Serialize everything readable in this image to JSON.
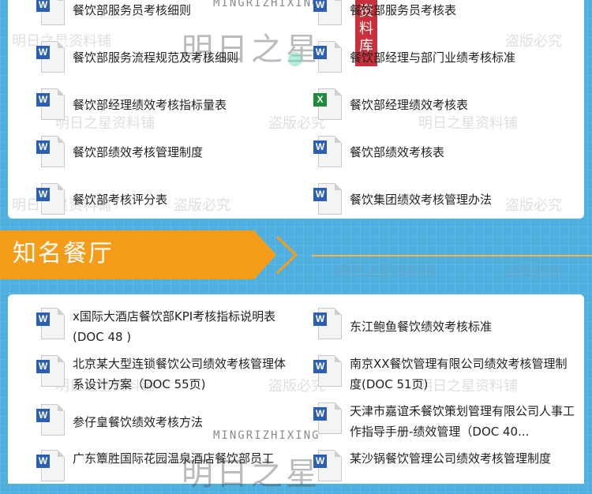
{
  "section_top": {
    "files": [
      {
        "name": "餐饮部服务员考核细则",
        "type": "word"
      },
      {
        "name": "餐饮部服务员考核表",
        "type": "word"
      },
      {
        "name": "餐饮部服务流程规范及考核细则",
        "type": "word"
      },
      {
        "name": "餐饮部经理与部门业绩考核标准",
        "type": "word"
      },
      {
        "name": "餐饮部经理绩效考核指标量表",
        "type": "word"
      },
      {
        "name": "餐饮部经理绩效考核表",
        "type": "excel"
      },
      {
        "name": "餐饮部绩效考核管理制度",
        "type": "word"
      },
      {
        "name": "餐饮部绩效考核表",
        "type": "word"
      },
      {
        "name": "餐饮部考核评分表",
        "type": "word"
      },
      {
        "name": "餐饮集团绩效考核管理办法",
        "type": "word"
      }
    ]
  },
  "banner": {
    "title": "知名餐厅"
  },
  "section_bottom": {
    "files": [
      {
        "name": "x国际大酒店餐饮部KPI考核指标说明表(DOC 48 )",
        "type": "word"
      },
      {
        "name": "东江鲍鱼餐饮绩效考核标准",
        "type": "word"
      },
      {
        "name": "北京某大型连锁餐饮公司绩效考核管理体系设计方案（DOC 55页)",
        "type": "word"
      },
      {
        "name": "南京XX餐饮管理有限公司绩效考核管理制度(DOC 51页)",
        "type": "word"
      },
      {
        "name": "参仔皇餐饮绩效考核方法",
        "type": "word"
      },
      {
        "name": "天津市嘉谊禾餐饮策划管理有限公司人事工作指导手册-绩效管理（DOC 40...",
        "type": "word"
      },
      {
        "name": "广东簟胜国际花园温泉酒店餐饮部员工",
        "type": "word"
      },
      {
        "name": "某沙锅餐饮管理公司绩效考核管理制度",
        "type": "word"
      }
    ]
  },
  "watermarks": {
    "brand": "明日之星资料铺",
    "notice": "盗版必究",
    "pinyin": "MINGRIZHIXING",
    "logo": "明日之星",
    "stamp": "资料库"
  },
  "icons": {
    "word": "W",
    "excel": "X"
  },
  "colors": {
    "accent": "#f59d19",
    "background": "#4fb0e0",
    "word": "#2b5fb3",
    "excel": "#1f8a3c"
  }
}
